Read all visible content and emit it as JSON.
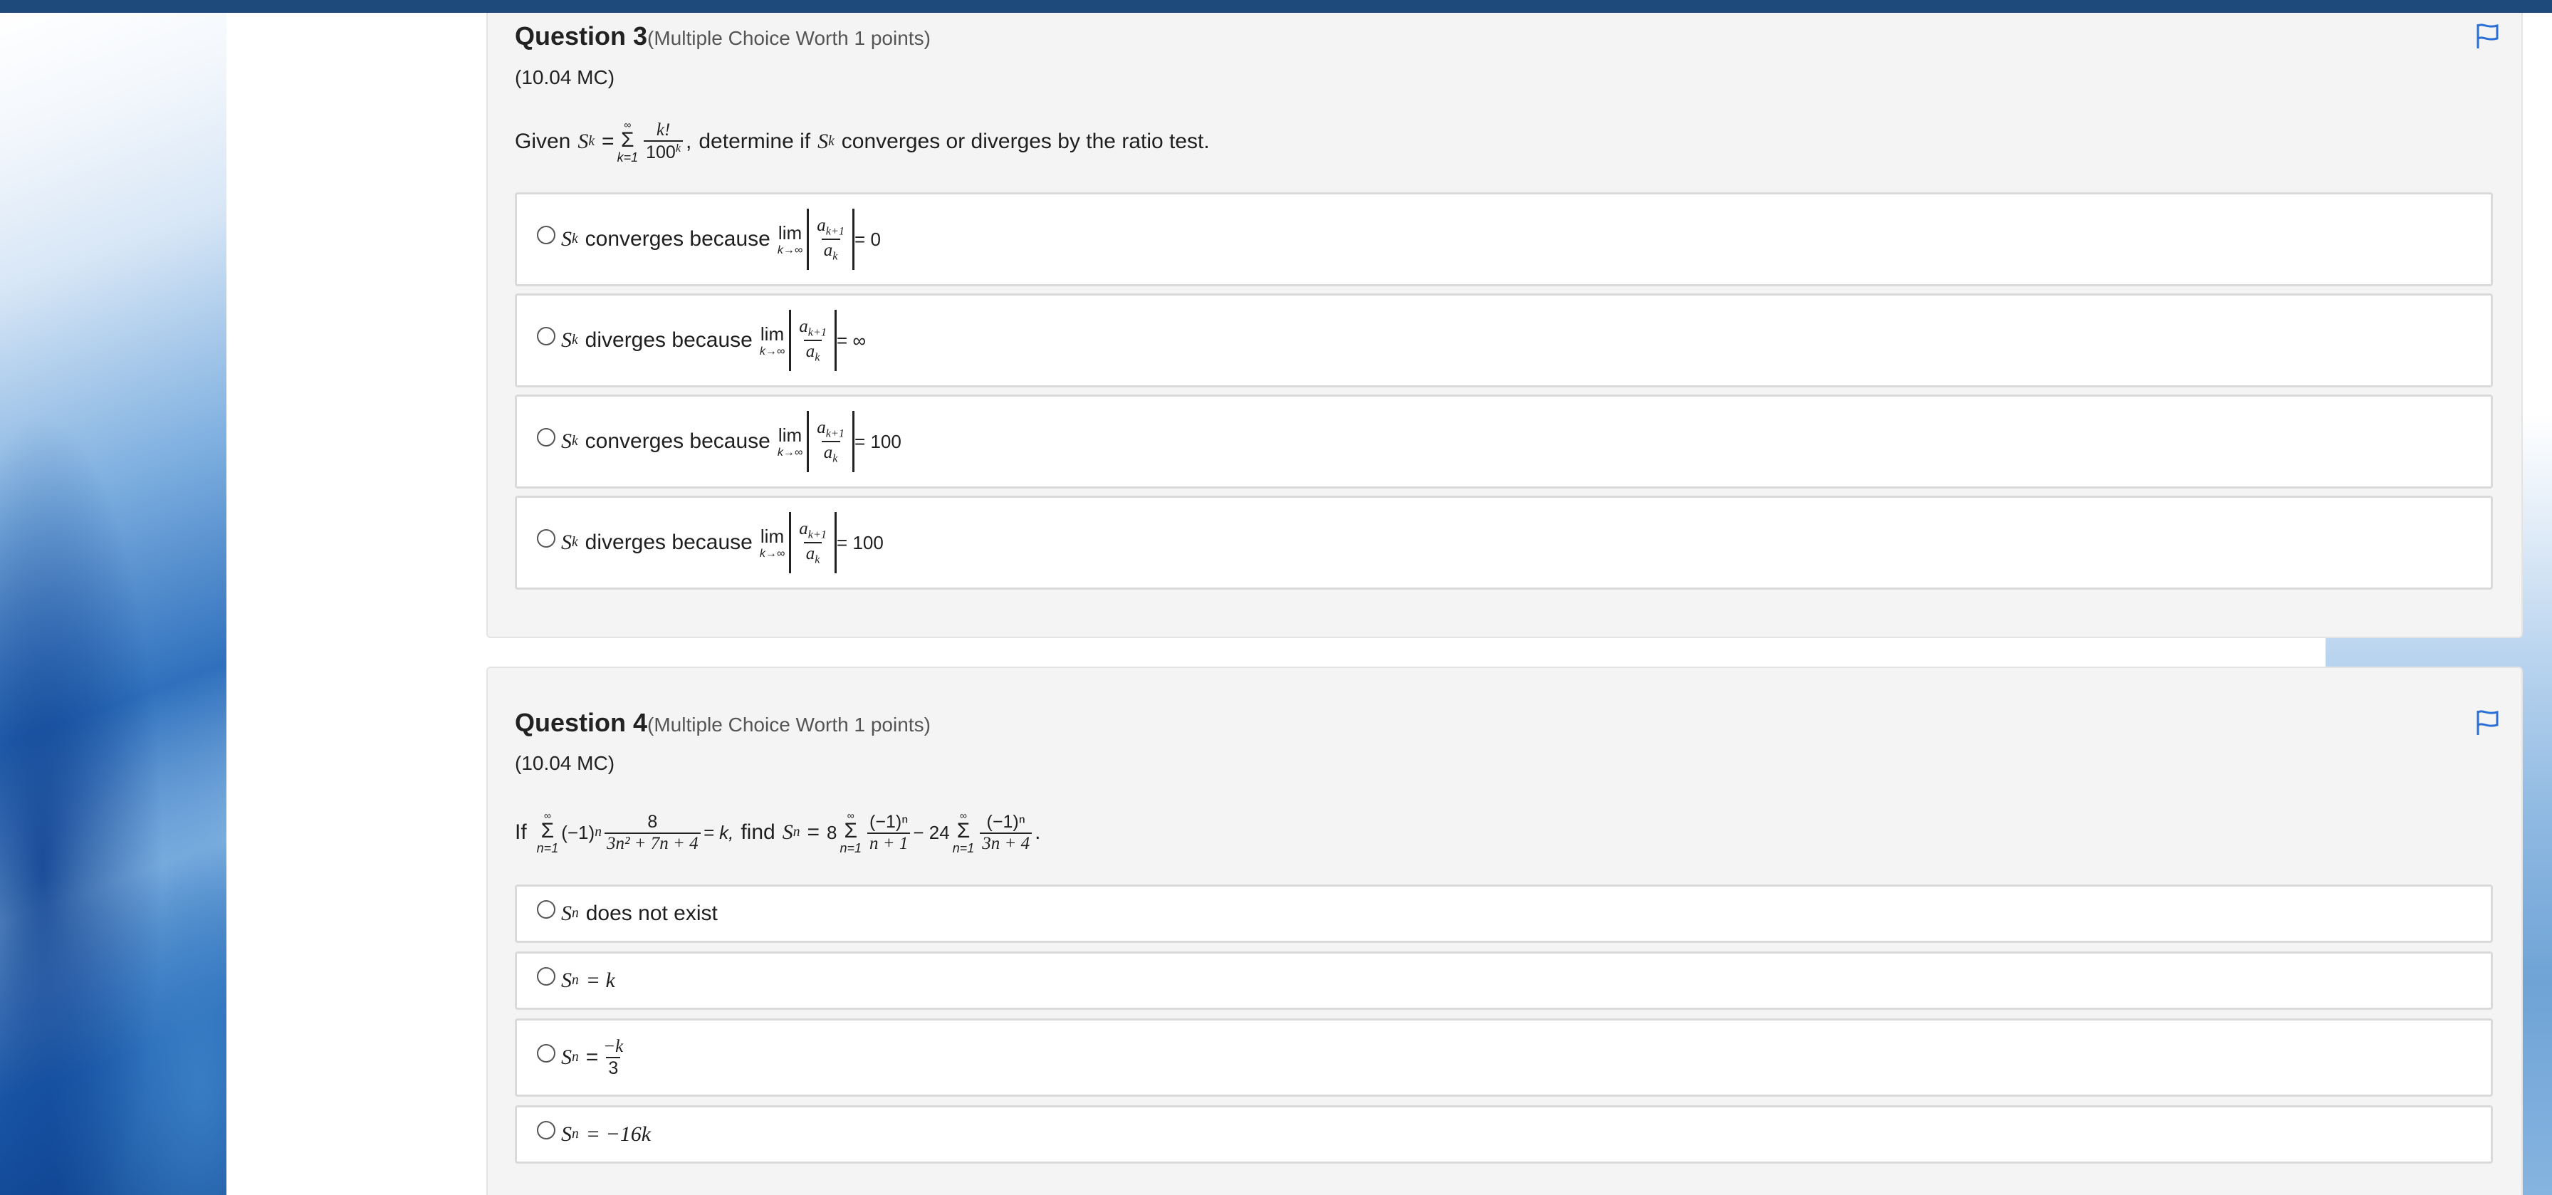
{
  "questions": [
    {
      "title": "Question 3",
      "worth": "(Multiple Choice Worth 1 points)",
      "code": "(10.04 MC)",
      "prompt": {
        "given": "Given",
        "S": "S",
        "k": "k",
        "eq": "=",
        "sum_top": "∞",
        "sum_sym": "Σ",
        "sum_bot": "k=1",
        "num": "k!",
        "den_base": "100",
        "den_exp": "k",
        "comma": ",",
        "rest_before": "determine if",
        "rest_after": "converges or diverges by the ratio test."
      },
      "options": [
        {
          "text": "converges because",
          "rhs": "= 0"
        },
        {
          "text": "diverges because",
          "rhs": "= ∞"
        },
        {
          "text": "converges because",
          "rhs": "= 100"
        },
        {
          "text": "diverges because",
          "rhs": "= 100"
        }
      ],
      "lim": {
        "word": "lim",
        "under": "k→∞",
        "num": "a",
        "num_sub": "k+1",
        "den": "a",
        "den_sub": "k"
      }
    },
    {
      "title": "Question 4",
      "worth": "(Multiple Choice Worth 1 points)",
      "code": "(10.04 MC)",
      "prompt": {
        "if": "If",
        "sum_top": "∞",
        "sum_sym": "Σ",
        "sum_bot": "n=1",
        "neg1": "(−1)",
        "n": "n",
        "num1": "8",
        "den1": "3n² + 7n + 4",
        "eq_k": "= k,",
        "find": "find",
        "S": "S",
        "eq": "=",
        "coef1": "8",
        "num2": "(−1)ⁿ",
        "den2": "n + 1",
        "minus": "− 24",
        "num3": "(−1)ⁿ",
        "den3": "3n + 4",
        "period": "."
      },
      "options": [
        {
          "S": "S",
          "sub": "n",
          "text": "does not exist"
        },
        {
          "S": "S",
          "sub": "n",
          "text": "= k"
        },
        {
          "S": "S",
          "sub": "n",
          "text": "=",
          "frac_num": "−k",
          "frac_den": "3"
        },
        {
          "S": "S",
          "sub": "n",
          "text": "= −16k"
        }
      ]
    }
  ],
  "icons": {
    "flag": "flag-icon"
  },
  "colors": {
    "topbar": "#1d4a7a",
    "flag": "#2a6fd6"
  }
}
